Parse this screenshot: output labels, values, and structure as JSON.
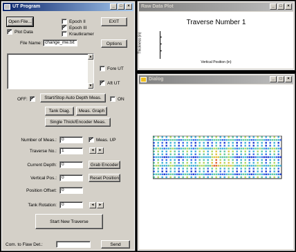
{
  "ut_window": {
    "title": "UT Program",
    "open_file": "Open File...",
    "exit": "EXIT",
    "epoch2": "Epoch II",
    "epoch3": "Epoch III",
    "krautkramer": "Krautkramer",
    "plot_data": "Plot Data",
    "file_name_label": "File Name:",
    "file_name_value": "change_me.txt",
    "options": "Options",
    "fore_ut": "Fore UT",
    "aft_ut": "Aft UT",
    "off_label": "OFF:",
    "start_stop": "Start/Stop Auto Depth Meas.",
    "on_label": "ON",
    "tank_diag": "Tank Diag.",
    "meas_graph": "Meas. Graph",
    "single_thick": "Single Thick/Encoder Meas.",
    "num_meas_label": "Number of Meas.:",
    "num_meas_value": "0",
    "meas_up": "Meas. UP",
    "traverse_no_label": "Traverse No.:",
    "traverse_no_value": "1",
    "current_depth_label": "Current Depth:",
    "current_depth_value": "0",
    "grab_encoder": "Grab Encoder",
    "vertical_pos_label": "Vertical Pos.:",
    "vertical_pos_value": "0",
    "reset_position": "Reset Position",
    "position_offset_label": "Position Offset:",
    "position_offset_value": "0",
    "tank_rotation_label": "Tank Rotation:",
    "tank_rotation_value": "0",
    "start_new_traverse": "Start New Traverse",
    "com_label": "Com. to Flaw Det.:",
    "send": "Send",
    "check_mark": "✓",
    "spin_left": "◄",
    "spin_right": "►"
  },
  "raw_plot": {
    "title": "Raw Data Plot",
    "heading": "Traverse Number 1",
    "ylabel": "Thickness (in)",
    "xlabel": "Vertical Position (in)"
  },
  "dialog": {
    "title": "Dialog"
  },
  "colors": {
    "heatmap_low": "#2040e0",
    "heatmap_mid": "#40c0a0",
    "heatmap_high": "#e03020"
  }
}
